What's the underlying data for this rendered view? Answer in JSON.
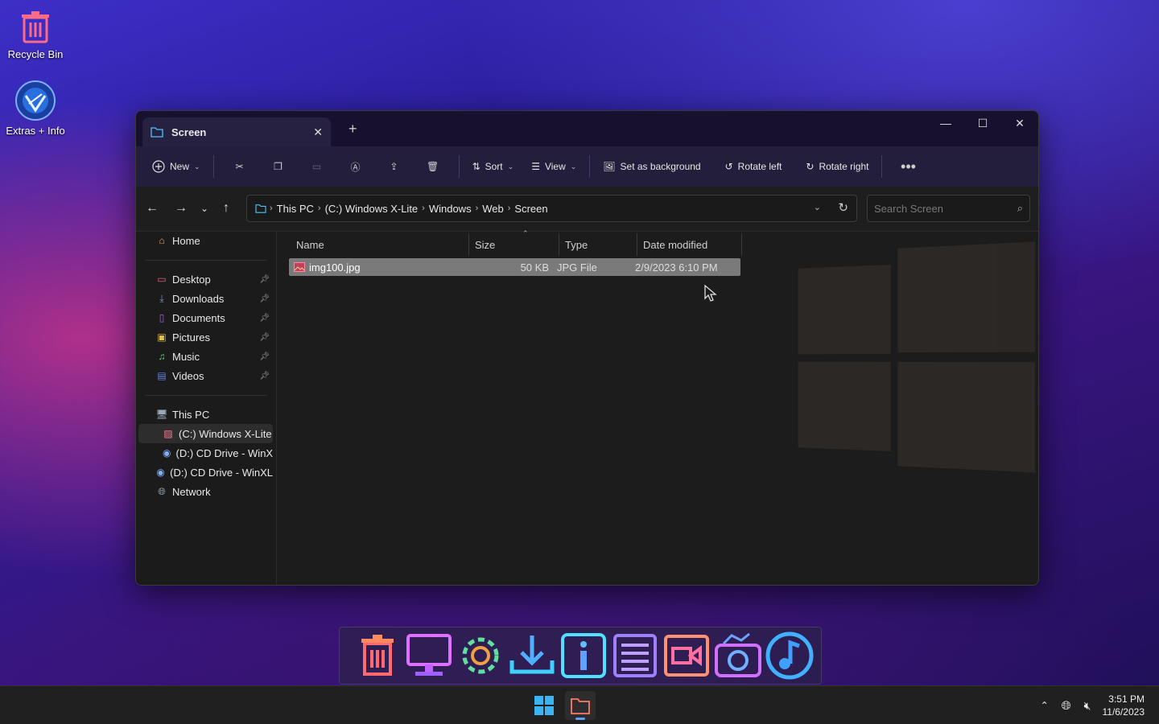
{
  "desktop": {
    "icons": [
      {
        "label": "Recycle Bin",
        "icon": "recycle-bin-icon"
      },
      {
        "label": "Extras + Info",
        "icon": "extras-info-icon"
      }
    ]
  },
  "window": {
    "tab_title": "Screen",
    "toolbar": {
      "new_label": "New",
      "sort_label": "Sort",
      "view_label": "View",
      "set_bg_label": "Set as background",
      "rotate_left_label": "Rotate left",
      "rotate_right_label": "Rotate right"
    },
    "breadcrumbs": [
      "This PC",
      "(C:) Windows X-Lite",
      "Windows",
      "Web",
      "Screen"
    ],
    "search_placeholder": "Search Screen",
    "nav": {
      "home": "Home",
      "quick_access": [
        {
          "label": "Desktop",
          "icon": "desktop-icon",
          "color": "#e0607e"
        },
        {
          "label": "Downloads",
          "icon": "downloads-icon",
          "color": "#8090d0"
        },
        {
          "label": "Documents",
          "icon": "documents-icon",
          "color": "#a060e0"
        },
        {
          "label": "Pictures",
          "icon": "pictures-icon",
          "color": "#e0c040"
        },
        {
          "label": "Music",
          "icon": "music-icon",
          "color": "#60d080"
        },
        {
          "label": "Videos",
          "icon": "videos-icon",
          "color": "#6080e0"
        }
      ],
      "this_pc": "This PC",
      "drives": [
        {
          "label": "(C:) Windows X-Lite",
          "selected": true
        },
        {
          "label": "(D:) CD Drive - WinX",
          "selected": false
        }
      ],
      "cd_drive": "(D:) CD Drive - WinXL",
      "network": "Network"
    },
    "columns": [
      "Name",
      "Size",
      "Type",
      "Date modified"
    ],
    "files": [
      {
        "name": "img100.jpg",
        "size": "50 KB",
        "type": "JPG File",
        "modified": "2/9/2023 6:10 PM"
      }
    ]
  },
  "dock": {
    "items": [
      "recycle-bin-icon",
      "monitor-icon",
      "settings-gear-icon",
      "download-icon",
      "info-icon",
      "documents-list-icon",
      "video-icon",
      "camera-icon",
      "music-icon"
    ]
  },
  "taskbar": {
    "time": "3:51 PM",
    "date": "11/6/2023"
  }
}
